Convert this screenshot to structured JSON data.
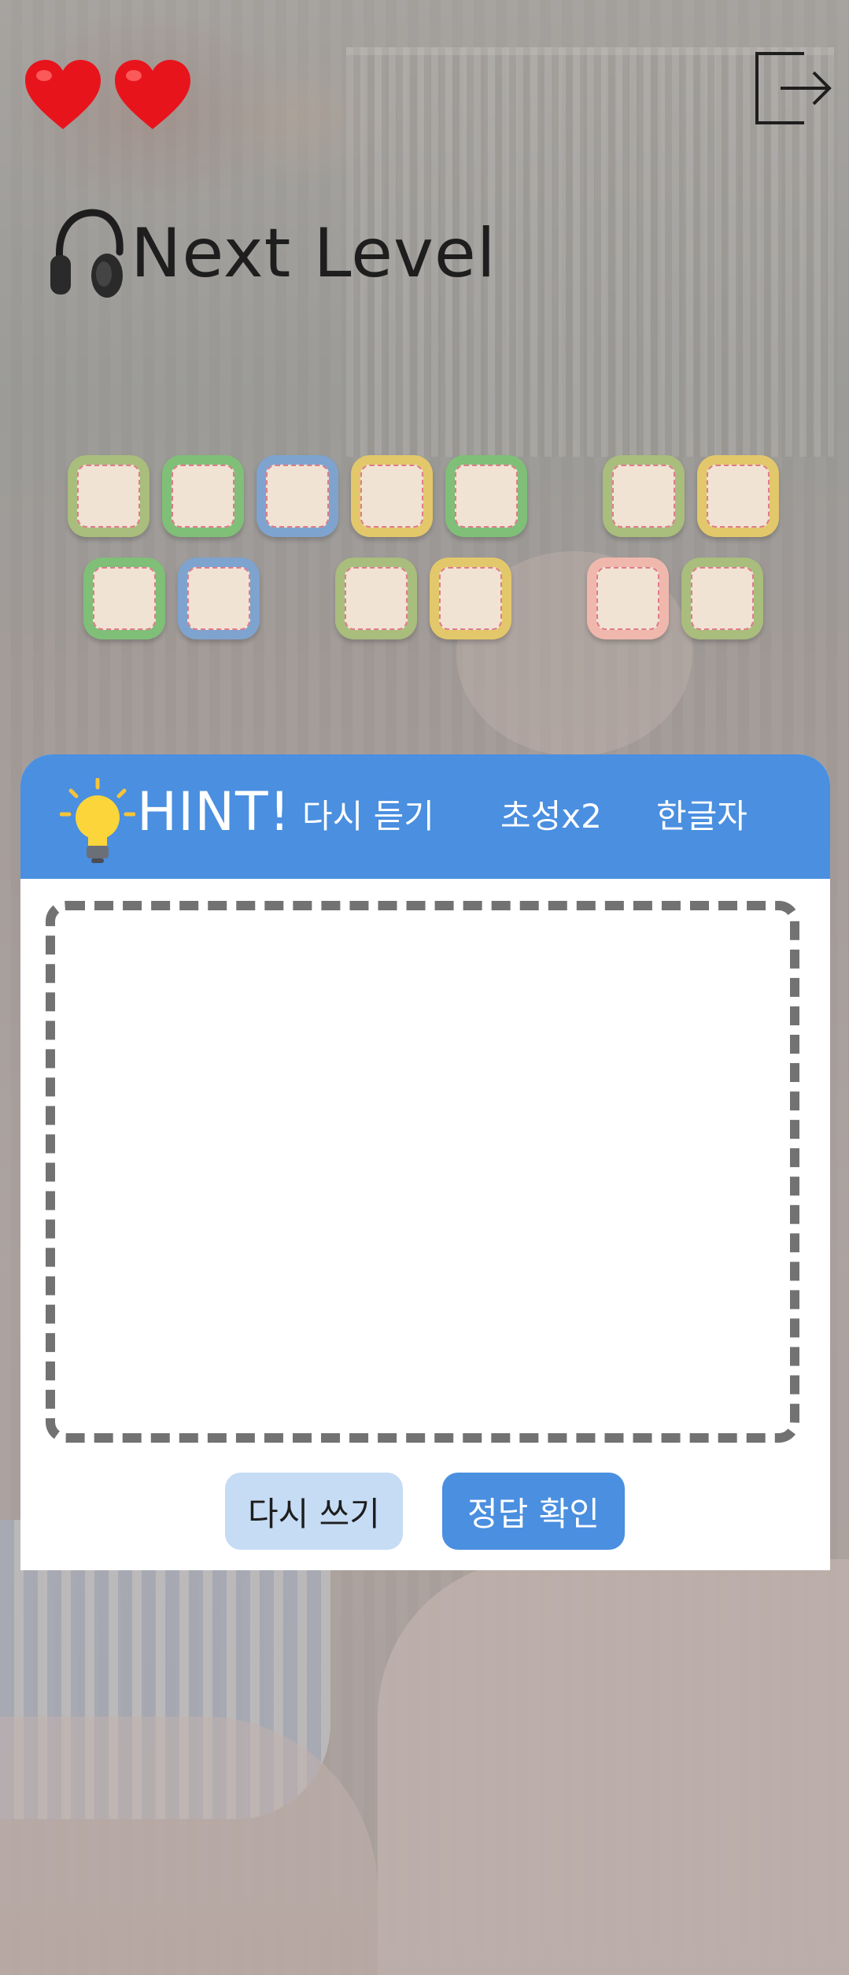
{
  "header": {
    "lives": [
      {
        "icon": "heart-icon",
        "color": "#e8141c"
      },
      {
        "icon": "heart-icon",
        "color": "#e8141c"
      }
    ],
    "exit_icon": "exit-icon",
    "title_icon": "headphones-icon",
    "title": "Next Level"
  },
  "answer_tiles": {
    "row1": [
      {
        "color": "#a9bd7c"
      },
      {
        "color": "#7fbf77"
      },
      {
        "color": "#7ea3cf"
      },
      {
        "color": "#e2c86b"
      },
      {
        "color": "#7fbf77"
      },
      {
        "color": "#a9bd7c"
      },
      {
        "color": "#e2c86b"
      }
    ],
    "row2": [
      {
        "color": "#7fbf77"
      },
      {
        "color": "#7ea3cf"
      },
      {
        "color": "#a9bd7c"
      },
      {
        "color": "#e2c86b"
      },
      {
        "color": "#f0b8ad"
      },
      {
        "color": "#a9bd7c"
      }
    ]
  },
  "hint": {
    "icon": "lightbulb-icon",
    "label": "HINT!",
    "options": [
      "다시 듣기",
      "초성x2",
      "한글자"
    ],
    "bar_color": "#4a8fe0"
  },
  "drawing": {
    "border_color": "#727272"
  },
  "actions": {
    "rewrite_label": "다시 쓰기",
    "submit_label": "정답 확인"
  }
}
